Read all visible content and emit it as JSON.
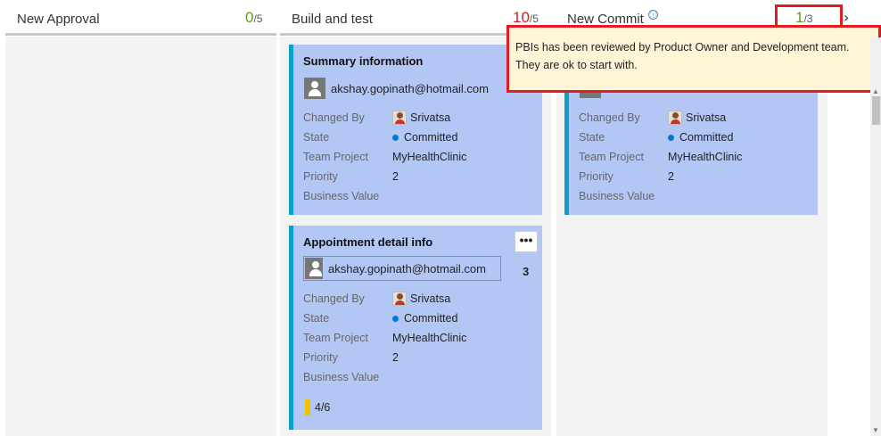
{
  "columns": [
    {
      "title": "New Approval",
      "count": "0",
      "limit": "/5"
    },
    {
      "title": "Build and test",
      "count": "10",
      "limit": "/5"
    },
    {
      "title": "New Commit",
      "count": "1",
      "limit": "/3"
    }
  ],
  "tooltip": {
    "text": "PBIs has been reviewed by Product Owner and Development team. They are ok to start with."
  },
  "field_labels": {
    "changed_by": "Changed By",
    "state": "State",
    "team_project": "Team Project",
    "priority": "Priority",
    "business_value": "Business Value"
  },
  "cards": [
    {
      "title": "Summary information",
      "assignee": "akshay.gopinath@hotmail.com",
      "changed_by": "Srivatsa",
      "state": "Committed",
      "team_project": "MyHealthClinic",
      "priority": "2",
      "business_value": ""
    },
    {
      "title": "Appointment detail info",
      "assignee": "akshay.gopinath@hotmail.com",
      "changed_by": "Srivatsa",
      "state": "Committed",
      "team_project": "MyHealthClinic",
      "priority": "2",
      "business_value": "",
      "number": "3",
      "tasks": "4/6",
      "more_label": "•••"
    },
    {
      "title": "",
      "assignee": "",
      "changed_by": "Srivatsa",
      "state": "Committed",
      "team_project": "MyHealthClinic",
      "priority": "2",
      "business_value": ""
    }
  ],
  "icons": {
    "info": "ⓘ",
    "chevron": "›",
    "scroll_up": "▲",
    "scroll_down": "▼"
  },
  "colors": {
    "card_bg": "#b3c7f5",
    "card_accent": "#0aa0c8",
    "count_ok": "#5a9e1a",
    "count_over": "#d0202a",
    "highlight": "#e41b23",
    "tooltip_bg": "#fef5d6"
  }
}
